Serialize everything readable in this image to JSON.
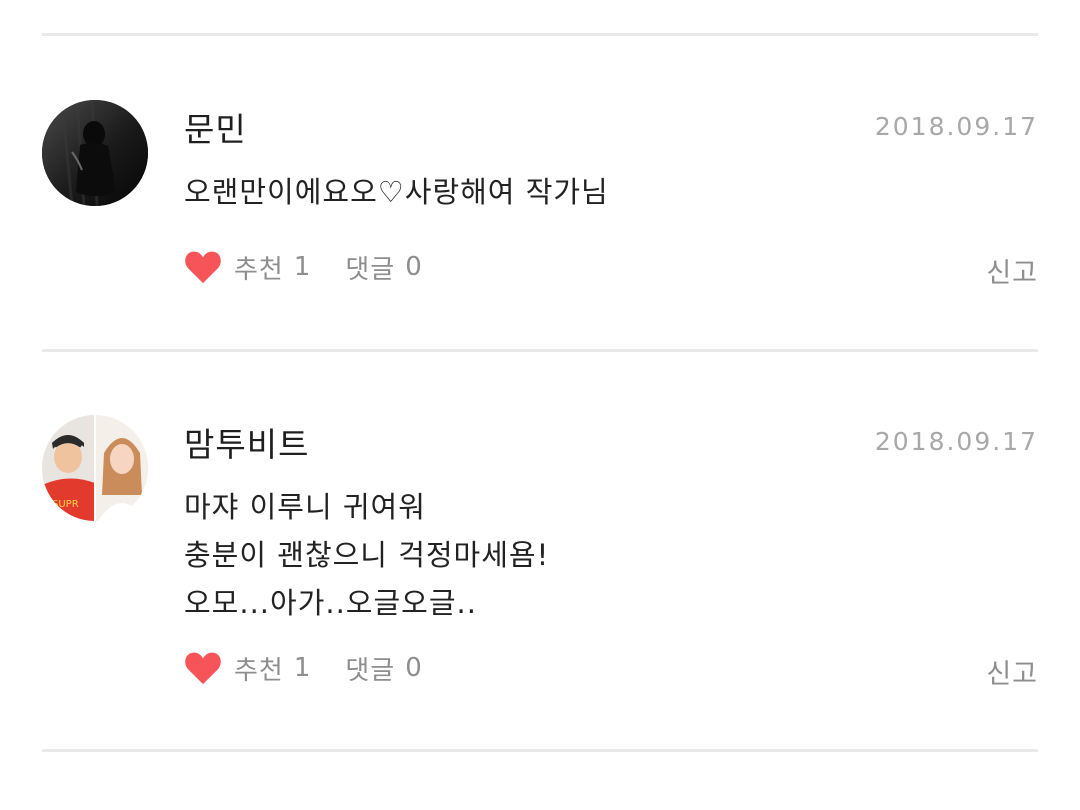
{
  "comments": [
    {
      "author": "문민",
      "date": "2018.09.17",
      "lines": [
        "오랜만이에요오♡사랑해여 작가님"
      ],
      "recommend_label": "추천",
      "recommend_count": "1",
      "reply_label": "댓글",
      "reply_count": "0",
      "report_label": "신고",
      "avatar_icon": "dark-silhouette-avatar"
    },
    {
      "author": "맘투비트",
      "date": "2018.09.17",
      "lines": [
        "마쟈 이루니 귀여워",
        "충분이 괜찮으니 걱정마세욤!",
        "오모...아가..오글오글.."
      ],
      "recommend_label": "추천",
      "recommend_count": "1",
      "reply_label": "댓글",
      "reply_count": "0",
      "report_label": "신고",
      "avatar_icon": "two-people-photo-avatar"
    }
  ],
  "colors": {
    "heart": "#f7545a",
    "divider": "#e9e9e9",
    "muted_text": "#8e8e8e",
    "date_text": "#a8a8a8"
  }
}
